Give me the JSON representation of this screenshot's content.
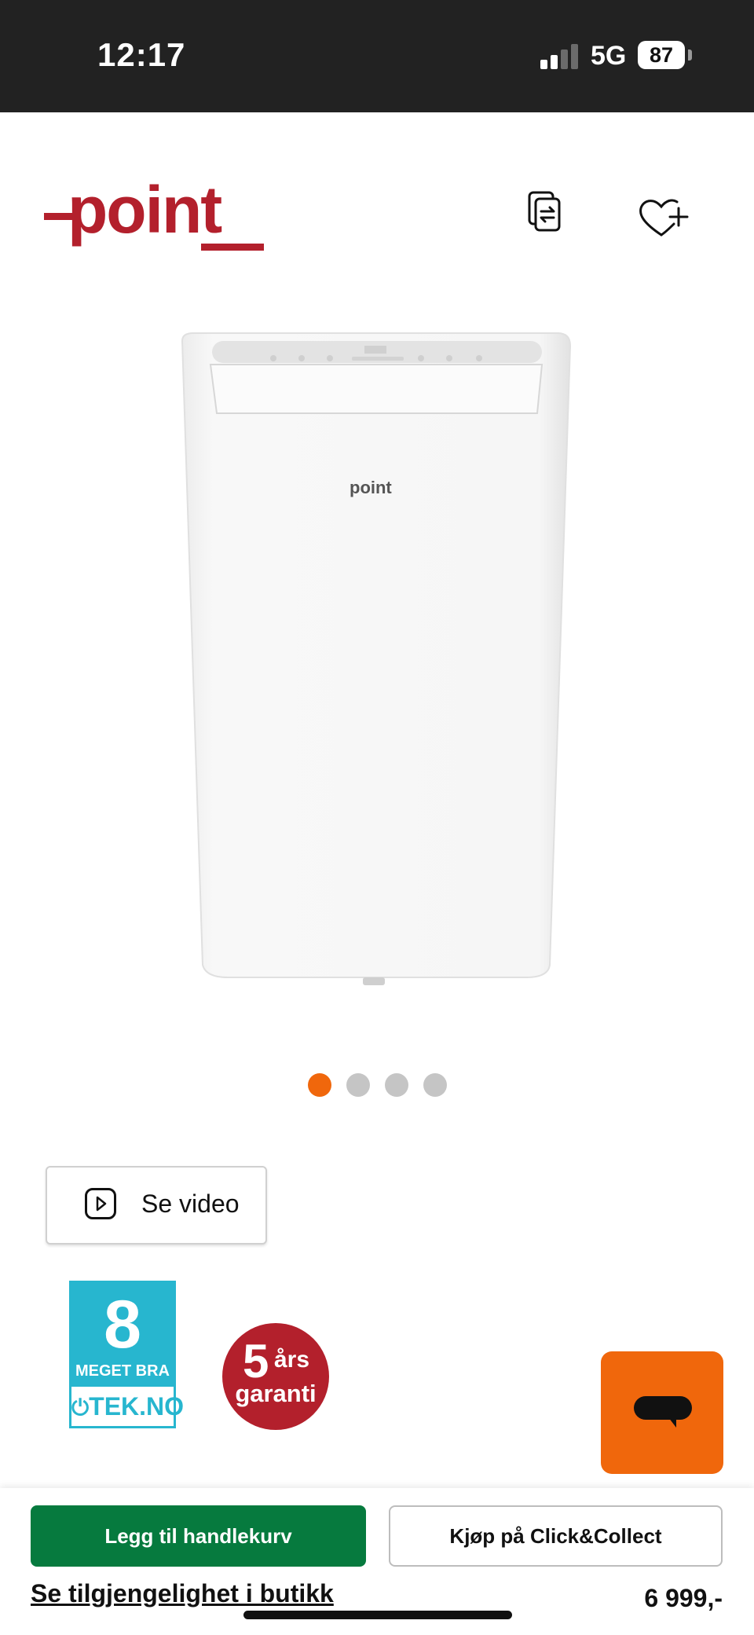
{
  "status_bar": {
    "time": "12:17",
    "network": "5G",
    "battery": "87",
    "signal_bars": 4,
    "signal_bars_active": 2
  },
  "header": {
    "logo_text": "point",
    "compare_icon": "compare-icon",
    "wishlist_icon": "heart-plus-icon",
    "brand_color": "#b3202c"
  },
  "product": {
    "image_logo": "point"
  },
  "gallery": {
    "count": 4,
    "active_index": 0,
    "active_color": "#f0670c"
  },
  "video_button": {
    "label": "Se video",
    "icon": "play-icon"
  },
  "badges": {
    "tek": {
      "score": "8",
      "grade": "MEGET BRA",
      "source": "TEK.NO"
    },
    "garanti": {
      "number": "5",
      "unit": "års",
      "text": "garanti"
    }
  },
  "chat": {
    "icon": "chat-bubble-icon",
    "color": "#f0670c"
  },
  "actions": {
    "add_to_cart": "Legg til handlekurv",
    "click_collect": "Kjøp på Click&Collect",
    "store_availability": "Se tilgjengelighet i butikk",
    "price": "6 999,-"
  }
}
